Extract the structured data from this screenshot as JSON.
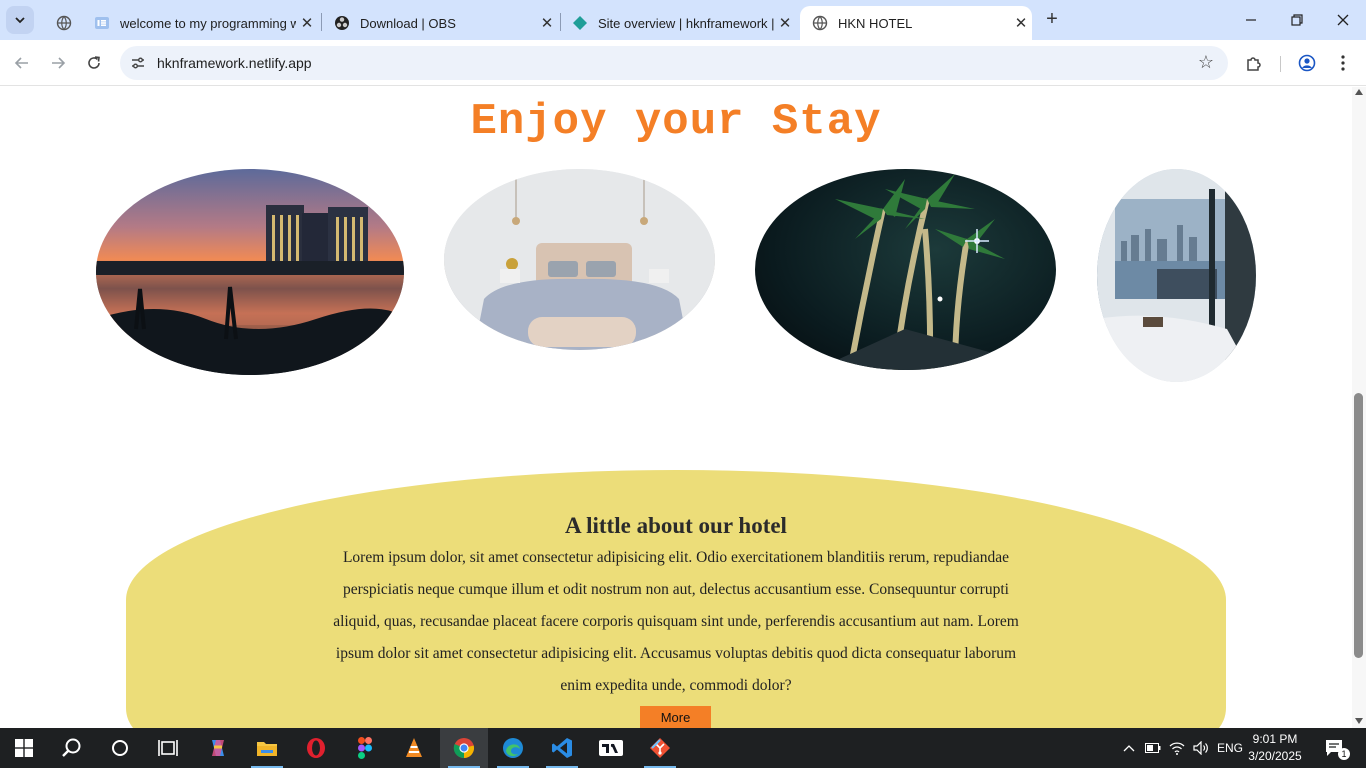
{
  "browser": {
    "tabs": [
      {
        "title": "welcome to my programming w",
        "icon": "elementor-icon"
      },
      {
        "title": "Download | OBS",
        "icon": "obs-icon"
      },
      {
        "title": "Site overview | hknframework | N",
        "icon": "netlify-icon"
      },
      {
        "title": "HKN HOTEL",
        "icon": "globe-icon"
      }
    ],
    "address": "hknframework.netlify.app"
  },
  "page": {
    "hero_title": "Enjoy your Stay",
    "gallery": [
      {
        "name": "hotel-lake-sunset-image"
      },
      {
        "name": "hotel-bedroom-image"
      },
      {
        "name": "palm-trees-night-image"
      },
      {
        "name": "city-view-room-image"
      }
    ],
    "about": {
      "heading": "A little about our hotel",
      "body": "Lorem ipsum dolor, sit amet consectetur adipisicing elit. Odio exercitationem blanditiis rerum, repudiandae perspiciatis neque cumque illum et odit nostrum non aut, delectus accusantium esse. Consequuntur corrupti aliquid, quas, recusandae placeat facere corporis quisquam sint unde, perferendis accusantium aut nam. Lorem ipsum dolor sit amet consectetur adipisicing elit. Accusamus voluptas debitis quod dicta consequatur laborum enim expedita unde, commodi dolor?",
      "button": "More"
    },
    "colors": {
      "accent": "#f47f26",
      "about_bg": "#ecdd79",
      "chrome": "#d3e3fd"
    }
  },
  "taskbar": {
    "language": "ENG",
    "time": "9:01 PM",
    "date": "3/20/2025",
    "notification_count": "1"
  }
}
